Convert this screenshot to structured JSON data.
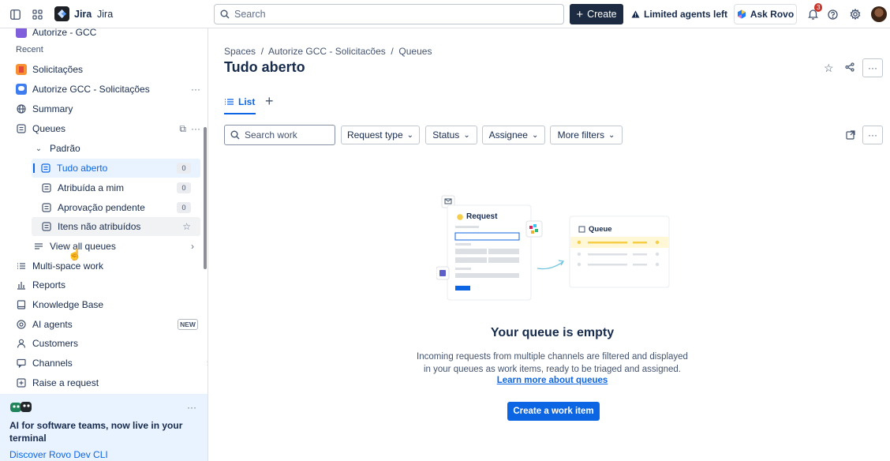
{
  "topbar": {
    "app_name": "Jira",
    "search_placeholder": "Search",
    "create_label": "Create",
    "limited_label": "Limited agents left",
    "ask_rovo_label": "Ask Rovo",
    "notification_count": "3"
  },
  "sidebar": {
    "top_project": "Autorize - GCC",
    "recent_label": "Recent",
    "items": {
      "solicitacoes": "Solicitações",
      "project": "Autorize GCC - Solicitações",
      "summary": "Summary",
      "queues": "Queues",
      "padrao": "Padrão",
      "tudo_aberto": "Tudo aberto",
      "tudo_aberto_count": "0",
      "atribuida": "Atribuída a mim",
      "atribuida_count": "0",
      "aprovacao": "Aprovação pendente",
      "aprovacao_count": "0",
      "itens": "Itens não atribuídos",
      "view_all": "View all queues",
      "multi_space": "Multi-space work",
      "reports": "Reports",
      "knowledge": "Knowledge Base",
      "ai_agents": "AI agents",
      "new_badge": "NEW",
      "customers": "Customers",
      "channels": "Channels",
      "raise": "Raise a request"
    },
    "promo": {
      "title": "AI for software teams, now live in your terminal",
      "link": "Discover Rovo Dev CLI"
    }
  },
  "main": {
    "breadcrumb": "Spaces  /  Autorize GCC - Solicitacões  /  Queues",
    "title": "Tudo aberto",
    "tab_list": "List",
    "search_placeholder": "Search work",
    "filters": [
      "Request type",
      "Status",
      "Assignee",
      "More filters"
    ],
    "illustration": {
      "request_label": "Request",
      "queue_label": "Queue"
    },
    "empty_title": "Your queue is empty",
    "empty_desc_line1": "Incoming requests from multiple channels are filtered and displayed",
    "empty_desc_line2": "in your queues as work items, ready to be triaged and assigned.",
    "learn_link": "Learn more about queues",
    "create_button": "Create a work item"
  },
  "colors": {
    "brand_blue": "#0c66e4",
    "create_bg": "#1c2b41",
    "selected_bg": "#e9f2ff",
    "hover_bg": "#f1f2f4"
  }
}
